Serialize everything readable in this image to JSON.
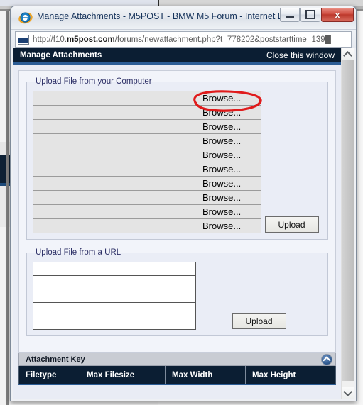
{
  "window": {
    "title": "Manage Attachments - M5POST - BMW M5 Forum - Internet E...",
    "app_icon": "internet-explorer-icon",
    "minimize_label": "Minimize",
    "maximize_label": "Maximize",
    "close_label": "x"
  },
  "address": {
    "icon": "page-icon",
    "url_prefix": "http://f10.",
    "url_domain": "m5post.com",
    "url_suffix": "/forums/newattachment.php?t=778202&poststarttime=139█",
    "full_url": "http://f10.m5post.com/forums/newattachment.php?t=778202&poststarttime=139"
  },
  "forum_header": {
    "title": "Manage Attachments",
    "close_link": "Close this window"
  },
  "upload_computer": {
    "legend": "Upload File from your Computer",
    "browse_label": "Browse...",
    "row_count": 10,
    "rows": [
      {
        "value": "",
        "browse": "Browse..."
      },
      {
        "value": "",
        "browse": "Browse..."
      },
      {
        "value": "",
        "browse": "Browse..."
      },
      {
        "value": "",
        "browse": "Browse..."
      },
      {
        "value": "",
        "browse": "Browse..."
      },
      {
        "value": "",
        "browse": "Browse..."
      },
      {
        "value": "",
        "browse": "Browse..."
      },
      {
        "value": "",
        "browse": "Browse..."
      },
      {
        "value": "",
        "browse": "Browse..."
      },
      {
        "value": "",
        "browse": "Browse..."
      }
    ],
    "upload_button": "Upload"
  },
  "upload_url": {
    "legend": "Upload File from a URL",
    "rows": [
      {
        "value": ""
      },
      {
        "value": ""
      },
      {
        "value": ""
      },
      {
        "value": ""
      },
      {
        "value": ""
      }
    ],
    "upload_button": "Upload"
  },
  "attachment_key": {
    "title": "Attachment Key",
    "collapse_icon": "collapse-icon",
    "columns": [
      "Filetype",
      "Max Filesize",
      "Max Width",
      "Max Height"
    ],
    "rows": []
  },
  "scrollbar": {
    "up_icon": "chevron-up-icon",
    "down_icon": "chevron-down-icon"
  },
  "annotation": {
    "type": "hand-drawn-red-ellipse",
    "target": "first-browse-button",
    "color": "#e01b1b"
  }
}
